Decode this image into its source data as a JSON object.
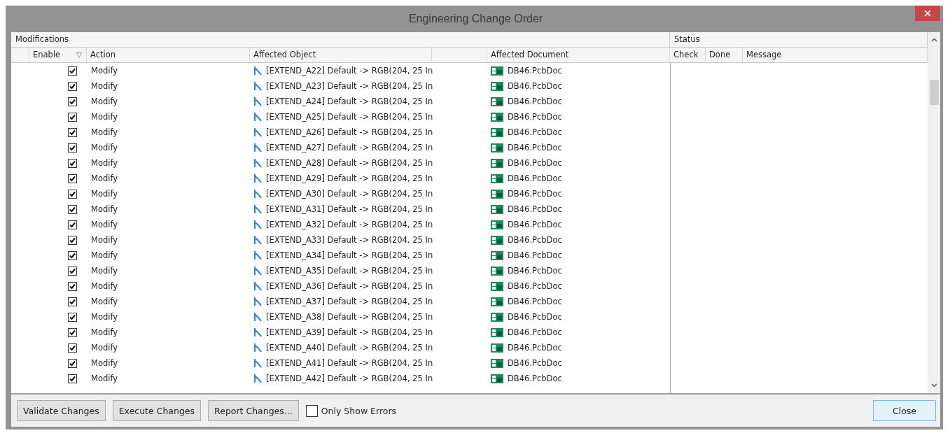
{
  "window": {
    "title": "Engineering Change Order"
  },
  "table": {
    "group_headers": [
      "Modifications",
      "Status"
    ],
    "columns": [
      "Enable",
      "Action",
      "Affected Object",
      "Affected Document",
      "Check",
      "Done",
      "Message"
    ],
    "rows": [
      {
        "enabled": true,
        "action": "Modify",
        "object": "[EXTEND_A22] Default -> RGB(204, 25 In",
        "document": "DB46.PcbDoc"
      },
      {
        "enabled": true,
        "action": "Modify",
        "object": "[EXTEND_A23] Default -> RGB(204, 25 In",
        "document": "DB46.PcbDoc"
      },
      {
        "enabled": true,
        "action": "Modify",
        "object": "[EXTEND_A24] Default -> RGB(204, 25 In",
        "document": "DB46.PcbDoc"
      },
      {
        "enabled": true,
        "action": "Modify",
        "object": "[EXTEND_A25] Default -> RGB(204, 25 In",
        "document": "DB46.PcbDoc"
      },
      {
        "enabled": true,
        "action": "Modify",
        "object": "[EXTEND_A26] Default -> RGB(204, 25 In",
        "document": "DB46.PcbDoc"
      },
      {
        "enabled": true,
        "action": "Modify",
        "object": "[EXTEND_A27] Default -> RGB(204, 25 In",
        "document": "DB46.PcbDoc"
      },
      {
        "enabled": true,
        "action": "Modify",
        "object": "[EXTEND_A28] Default -> RGB(204, 25 In",
        "document": "DB46.PcbDoc"
      },
      {
        "enabled": true,
        "action": "Modify",
        "object": "[EXTEND_A29] Default -> RGB(204, 25 In",
        "document": "DB46.PcbDoc"
      },
      {
        "enabled": true,
        "action": "Modify",
        "object": "[EXTEND_A30] Default -> RGB(204, 25 In",
        "document": "DB46.PcbDoc"
      },
      {
        "enabled": true,
        "action": "Modify",
        "object": "[EXTEND_A31] Default -> RGB(204, 25 In",
        "document": "DB46.PcbDoc"
      },
      {
        "enabled": true,
        "action": "Modify",
        "object": "[EXTEND_A32] Default -> RGB(204, 25 In",
        "document": "DB46.PcbDoc"
      },
      {
        "enabled": true,
        "action": "Modify",
        "object": "[EXTEND_A33] Default -> RGB(204, 25 In",
        "document": "DB46.PcbDoc"
      },
      {
        "enabled": true,
        "action": "Modify",
        "object": "[EXTEND_A34] Default -> RGB(204, 25 In",
        "document": "DB46.PcbDoc"
      },
      {
        "enabled": true,
        "action": "Modify",
        "object": "[EXTEND_A35] Default -> RGB(204, 25 In",
        "document": "DB46.PcbDoc"
      },
      {
        "enabled": true,
        "action": "Modify",
        "object": "[EXTEND_A36] Default -> RGB(204, 25 In",
        "document": "DB46.PcbDoc"
      },
      {
        "enabled": true,
        "action": "Modify",
        "object": "[EXTEND_A37] Default -> RGB(204, 25 In",
        "document": "DB46.PcbDoc"
      },
      {
        "enabled": true,
        "action": "Modify",
        "object": "[EXTEND_A38] Default -> RGB(204, 25 In",
        "document": "DB46.PcbDoc"
      },
      {
        "enabled": true,
        "action": "Modify",
        "object": "[EXTEND_A39] Default -> RGB(204, 25 In",
        "document": "DB46.PcbDoc"
      },
      {
        "enabled": true,
        "action": "Modify",
        "object": "[EXTEND_A40] Default -> RGB(204, 25 In",
        "document": "DB46.PcbDoc"
      },
      {
        "enabled": true,
        "action": "Modify",
        "object": "[EXTEND_A41] Default -> RGB(204, 25 In",
        "document": "DB46.PcbDoc"
      },
      {
        "enabled": true,
        "action": "Modify",
        "object": "[EXTEND_A42] Default -> RGB(204, 25 In",
        "document": "DB46.PcbDoc"
      }
    ]
  },
  "buttons": [
    "Validate Changes",
    "Execute Changes",
    "Report Changes..."
  ],
  "only_show_errors": {
    "label": "Only Show Errors",
    "checked": false
  },
  "close_button": "Close"
}
